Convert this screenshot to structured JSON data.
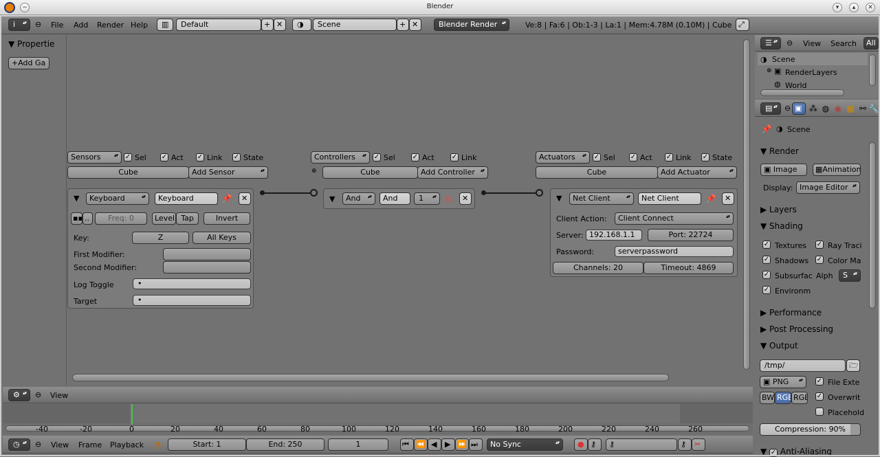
{
  "window": {
    "title": "Blender"
  },
  "top_header": {
    "menus": [
      "File",
      "Add",
      "Render",
      "Help"
    ],
    "layout": "Default",
    "scene": "Scene",
    "engine": "Blender Render",
    "stats": "Ve:8 | Fa:6 | Ob:1-3 | La:1 | Mem:4.78M (0.10M) | Cube"
  },
  "logic_editor": {
    "toolshelf": {
      "title": "Propertie",
      "add_button": "Add Ga"
    },
    "sensors": {
      "type": "Sensors",
      "sel": "Sel",
      "act": "Act",
      "link": "Link",
      "state": "State",
      "object": "Cube",
      "add": "Add Sensor",
      "brick": {
        "type": "Keyboard",
        "name": "Keyboard",
        "freq": "Freq: 0",
        "level": "Level",
        "tap": "Tap",
        "invert": "Invert",
        "key_label": "Key:",
        "key": "Z",
        "all_keys": "All Keys",
        "first_mod": "First Modifier:",
        "second_mod": "Second Modifier:",
        "log_toggle": "Log Toggle",
        "target": "Target",
        "dot": "•"
      }
    },
    "controllers": {
      "type": "Controllers",
      "sel": "Sel",
      "act": "Act",
      "link": "Link",
      "object": "Cube",
      "add": "Add Controller",
      "brick": {
        "type": "And",
        "name": "And",
        "state": "1"
      }
    },
    "actuators": {
      "type": "Actuators",
      "sel": "Sel",
      "act": "Act",
      "link": "Link",
      "state": "State",
      "object": "Cube",
      "add": "Add Actuator",
      "brick": {
        "type": "Net Client",
        "name": "Net Client",
        "client_action_label": "Client Action:",
        "client_action": "Client Connect",
        "server_label": "Server:",
        "server": "192.168.1.1",
        "port": "Port: 22724",
        "password_label": "Password:",
        "password": "serverpassword",
        "channels": "Channels: 20",
        "timeout": "Timeout: 4869"
      }
    },
    "view_menu": "View"
  },
  "timeline": {
    "ticks": [
      "-40",
      "-20",
      "0",
      "20",
      "40",
      "60",
      "80",
      "100",
      "120",
      "140",
      "160",
      "180",
      "200",
      "220",
      "240",
      "260"
    ],
    "current_frame": 0,
    "menus": [
      "View",
      "Frame",
      "Playback"
    ],
    "start": "Start: 1",
    "end": "End: 250",
    "frame": "1",
    "sync": "No Sync"
  },
  "outliner": {
    "menus": [
      "View",
      "Search",
      "All"
    ],
    "items": [
      "Scene",
      "RenderLayers",
      "World"
    ]
  },
  "properties": {
    "context": "Scene",
    "render": {
      "title": "Render",
      "image": "Image",
      "animation": "Animation",
      "display_label": "Display:",
      "display": "Image Editor"
    },
    "layers": "Layers",
    "shading": {
      "title": "Shading",
      "textures": "Textures",
      "ray": "Ray Traci",
      "shadows": "Shadows",
      "color": "Color Ma",
      "subsurface": "Subsurfac",
      "alpha_label": "Alph",
      "alpha": "S",
      "environment": "Environm"
    },
    "performance": "Performance",
    "post_processing": "Post Processing",
    "output": {
      "title": "Output",
      "path": "/tmp/",
      "format": "PNG",
      "file_ext": "File Exte",
      "bw": "BW",
      "rgb_sel": "RGB",
      "rgba": "RGB",
      "overwrite": "Overwrit",
      "placeholders": "Placehold",
      "compression": "Compression: 90%",
      "compression_value": 0.9
    },
    "anti_aliasing": "Anti-Aliasing"
  }
}
